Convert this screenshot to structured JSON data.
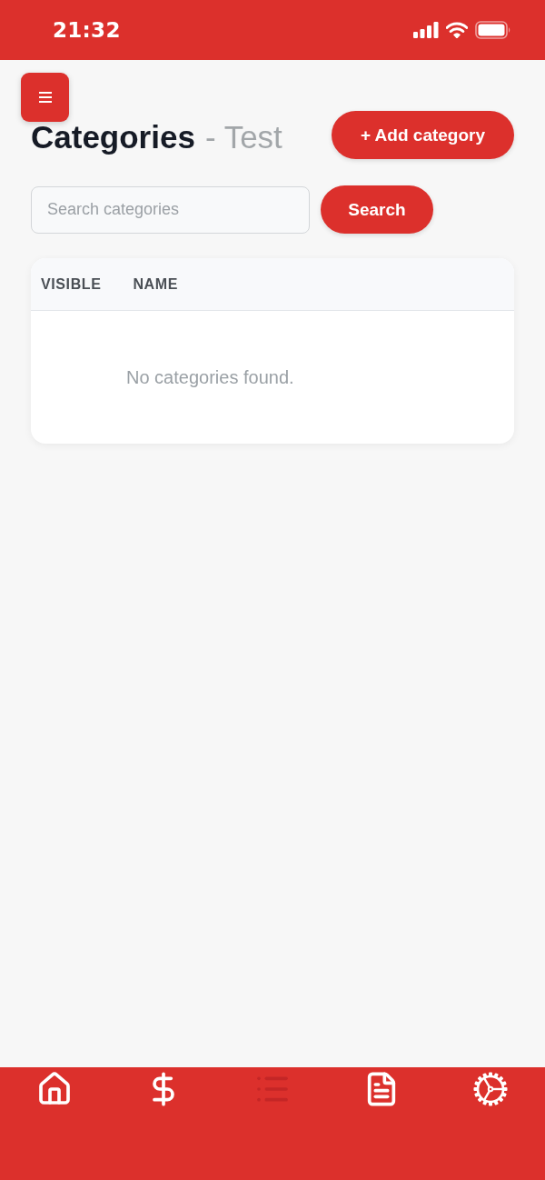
{
  "status_bar": {
    "time": "21:32"
  },
  "header": {
    "title": "Categories",
    "subtitle": "- Test",
    "add_button": "+ Add category"
  },
  "search": {
    "placeholder": "Search categories",
    "button": "Search"
  },
  "table": {
    "columns": [
      "VISIBLE",
      "NAME"
    ],
    "empty_message": "No categories found."
  },
  "bottom_nav": [
    {
      "selected": false
    },
    {
      "selected": false
    },
    {
      "selected": true
    },
    {
      "selected": false
    },
    {
      "selected": false
    }
  ]
}
